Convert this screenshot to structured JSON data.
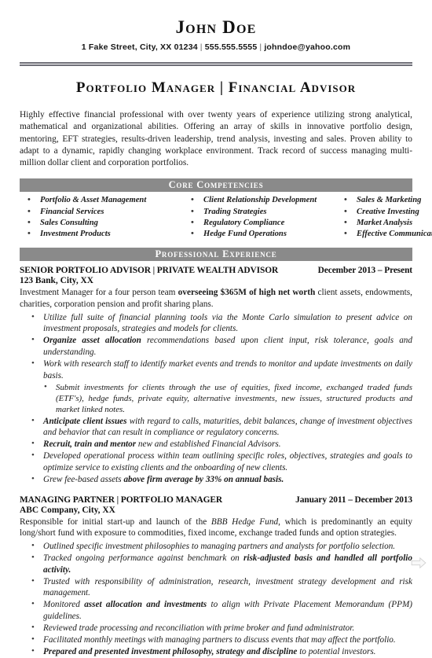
{
  "header": {
    "name": "John Doe",
    "address": "1 Fake Street,  City, XX 01234",
    "sep": "|",
    "phone": "555.555.5555",
    "email": "johndoe@yahoo.com",
    "headline": "Portfolio Manager | Financial Advisor"
  },
  "summary": {
    "text": "Highly effective financial professional with over twenty years of experience utilizing strong analytical, mathematical and organizational abilities. Offering an array of skills in innovative portfolio design, mentoring, EFT strategies, results-driven leadership, trend analysis, investing and sales. Proven ability to adapt to a dynamic, rapidly changing workplace environment. Track record of success managing multi-million dollar client and corporation portfolios."
  },
  "core_competencies": {
    "title": "Core Competencies",
    "columns": [
      [
        "Portfolio & Asset Management",
        "Financial Services",
        "Sales Consulting",
        "Investment Products"
      ],
      [
        "Client Relationship Development",
        "Trading Strategies",
        "Regulatory Compliance",
        "Hedge Fund Operations"
      ],
      [
        "Sales & Marketing",
        "Creative Investing",
        "Market Analysis",
        "Effective Communication"
      ]
    ]
  },
  "professional_experience": {
    "title": "Professional Experience",
    "jobs": [
      {
        "title": "SENIOR PORTFOLIO ADVISOR | PRIVATE WEALTH ADVISOR",
        "dates": "December 2013 – Present",
        "company": "123 Bank, City, XX",
        "description_pre": "Investment Manager for a four person team ",
        "description_bold": "overseeing $365M of high net worth",
        "description_post": " client assets, endowments, charities, corporation pension and profit sharing plans.",
        "bullets": [
          {
            "level": 1,
            "bold": "",
            "text": "Utilize full suite of financial planning tools via the Monte Carlo simulation to present advice on investment proposals, strategies and models for clients."
          },
          {
            "level": 1,
            "bold": "Organize asset allocation",
            "text": " recommendations based upon client input, risk tolerance, goals and understanding."
          },
          {
            "level": 1,
            "bold": "",
            "text": "Work with research staff to identify market events and trends to monitor and update investments on daily basis."
          },
          {
            "level": 2,
            "bold": "",
            "text": "Submit investments for clients through the use of equities, fixed income, exchanged traded funds (ETF's), hedge funds, private equity, alternative investments, new issues, structured products and market linked notes."
          },
          {
            "level": 1,
            "bold": "Anticipate client issues",
            "text": " with regard to calls, maturities, debit balances, change of investment objectives and behavior that can result in compliance or regulatory concerns."
          },
          {
            "level": 1,
            "bold": "Recruit, train and mentor",
            "text": " new and established Financial Advisors."
          },
          {
            "level": 1,
            "bold": "",
            "text": "Developed operational process within team outlining specific roles, objectives, strategies and goals to optimize service to existing clients and the onboarding of new clients."
          },
          {
            "level": 1,
            "bold": "",
            "text": "Grew fee-based assets ",
            "bold_after": "above firm average by 33% on annual basis."
          }
        ]
      },
      {
        "title": "MANAGING PARTNER | PORTFOLIO MANAGER",
        "dates": "January 2011 – December 2013",
        "company": "ABC Company, City, XX",
        "description_pre": "Responsible for initial start-up and launch of the ",
        "description_italic": "BBB Hedge Fund",
        "description_post": ", which is predominantly an equity long/short fund with exposure to commodities, fixed income, exchange traded funds and option strategies.",
        "bullets": [
          {
            "level": 1,
            "bold": "",
            "text": "Outlined specific investment philosophies to managing partners and analysts for portfolio selection."
          },
          {
            "level": 1,
            "bold": "",
            "text": "Tracked ongoing performance against benchmark on ",
            "bold_after": "risk-adjusted basis and handled all portfolio activity."
          },
          {
            "level": 1,
            "bold": "",
            "text": "Trusted with responsibility of administration, research, investment strategy development and risk management."
          },
          {
            "level": 1,
            "bold": "",
            "text": "Monitored ",
            "bold_mid": "asset allocation and investments",
            "text_after": " to align with Private Placement Memorandum (PPM) guidelines."
          },
          {
            "level": 1,
            "bold": "",
            "text": "Reviewed trade processing and reconciliation with prime broker and fund administrator."
          },
          {
            "level": 1,
            "bold": "",
            "text": "Facilitated monthly meetings with managing partners to discuss events that may affect the portfolio."
          },
          {
            "level": 1,
            "bold": "Prepared and presented investment philosophy, strategy and discipline",
            "text": " to potential investors."
          }
        ]
      }
    ]
  },
  "colors": {
    "section_bar_bg": "#8a8a8a",
    "section_bar_text": "#ffffff",
    "rule": "#6f6f78",
    "body_text": "#1a1a1a"
  }
}
